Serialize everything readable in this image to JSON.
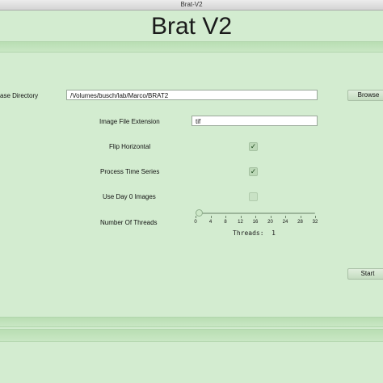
{
  "window": {
    "title": "Brat-V2"
  },
  "app": {
    "title": "Brat V2"
  },
  "form": {
    "base_directory": {
      "label": "ase Directory",
      "value": "/Volumes/busch/lab/Marco/BRAT2",
      "button_label": "Browse"
    },
    "image_extension": {
      "label": "Image File Extension",
      "value": "tif"
    },
    "flip_horizontal": {
      "label": "Flip Horizontal",
      "checked": true
    },
    "process_time_series": {
      "label": "Process Time Series",
      "checked": true
    },
    "use_day0": {
      "label": "Use Day 0 Images",
      "checked": false
    },
    "threads": {
      "label": "Number Of Threads",
      "min": 0,
      "max": 32,
      "value": 1,
      "ticks": [
        "0",
        "4",
        "8",
        "12",
        "16",
        "20",
        "24",
        "28",
        "32"
      ],
      "readout_label": "Threads:",
      "readout_value": "1"
    }
  },
  "actions": {
    "start_label": "Start"
  },
  "colors": {
    "background": "#d3ecd0",
    "band": "#c0e2ba"
  }
}
